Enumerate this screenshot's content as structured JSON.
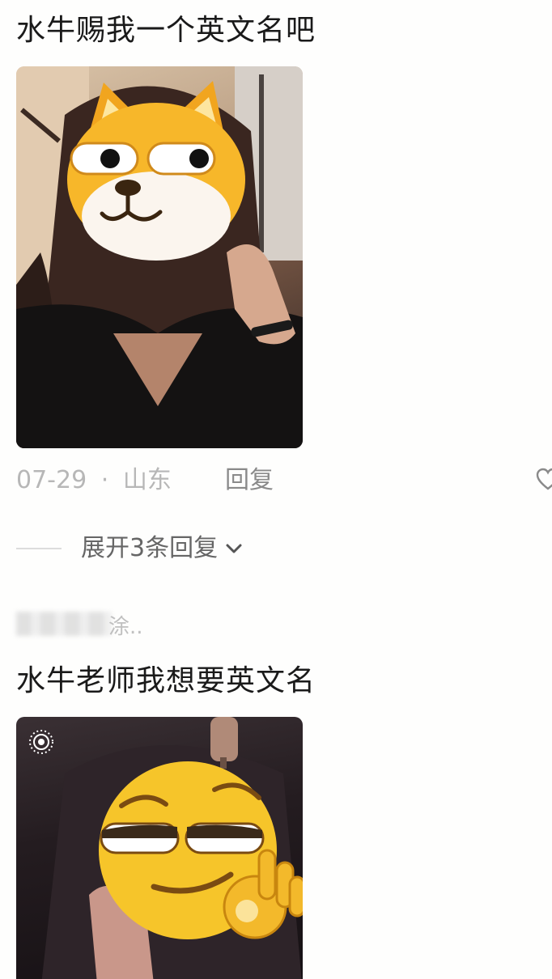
{
  "comment1": {
    "text": "水牛赐我一个英文名吧",
    "date": "07-29",
    "separator": "·",
    "location": "山东",
    "reply_label": "回复",
    "expand_label": "展开3条回复"
  },
  "comment2": {
    "username_suffix": "涂..",
    "text": "水牛老师我想要英文名"
  },
  "icons": {
    "like": "heart-icon",
    "expand": "chevron-down-icon",
    "live": "live-photo-icon",
    "sticker1": "shiba-dog-emoji",
    "sticker2": "smirk-ok-emoji"
  },
  "colors": {
    "meta": "#b7b7b7",
    "text": "#1a1a1a",
    "emoji_yellow": "#f7c52b"
  }
}
